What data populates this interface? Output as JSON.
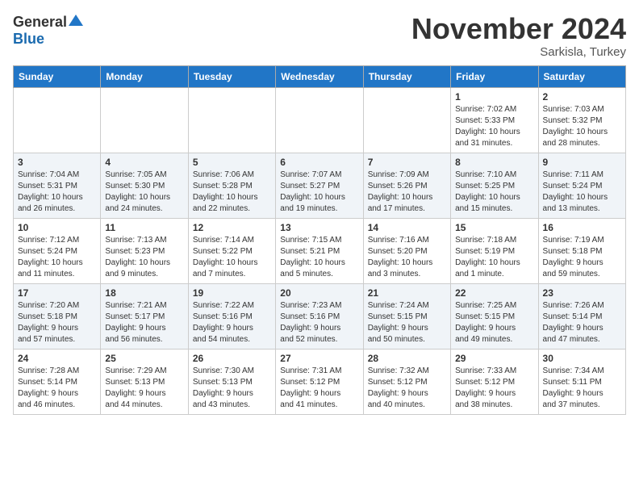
{
  "header": {
    "logo_general": "General",
    "logo_blue": "Blue",
    "month": "November 2024",
    "location": "Sarkisla, Turkey"
  },
  "weekdays": [
    "Sunday",
    "Monday",
    "Tuesday",
    "Wednesday",
    "Thursday",
    "Friday",
    "Saturday"
  ],
  "weeks": [
    [
      {
        "day": "",
        "info": ""
      },
      {
        "day": "",
        "info": ""
      },
      {
        "day": "",
        "info": ""
      },
      {
        "day": "",
        "info": ""
      },
      {
        "day": "",
        "info": ""
      },
      {
        "day": "1",
        "info": "Sunrise: 7:02 AM\nSunset: 5:33 PM\nDaylight: 10 hours\nand 31 minutes."
      },
      {
        "day": "2",
        "info": "Sunrise: 7:03 AM\nSunset: 5:32 PM\nDaylight: 10 hours\nand 28 minutes."
      }
    ],
    [
      {
        "day": "3",
        "info": "Sunrise: 7:04 AM\nSunset: 5:31 PM\nDaylight: 10 hours\nand 26 minutes."
      },
      {
        "day": "4",
        "info": "Sunrise: 7:05 AM\nSunset: 5:30 PM\nDaylight: 10 hours\nand 24 minutes."
      },
      {
        "day": "5",
        "info": "Sunrise: 7:06 AM\nSunset: 5:28 PM\nDaylight: 10 hours\nand 22 minutes."
      },
      {
        "day": "6",
        "info": "Sunrise: 7:07 AM\nSunset: 5:27 PM\nDaylight: 10 hours\nand 19 minutes."
      },
      {
        "day": "7",
        "info": "Sunrise: 7:09 AM\nSunset: 5:26 PM\nDaylight: 10 hours\nand 17 minutes."
      },
      {
        "day": "8",
        "info": "Sunrise: 7:10 AM\nSunset: 5:25 PM\nDaylight: 10 hours\nand 15 minutes."
      },
      {
        "day": "9",
        "info": "Sunrise: 7:11 AM\nSunset: 5:24 PM\nDaylight: 10 hours\nand 13 minutes."
      }
    ],
    [
      {
        "day": "10",
        "info": "Sunrise: 7:12 AM\nSunset: 5:24 PM\nDaylight: 10 hours\nand 11 minutes."
      },
      {
        "day": "11",
        "info": "Sunrise: 7:13 AM\nSunset: 5:23 PM\nDaylight: 10 hours\nand 9 minutes."
      },
      {
        "day": "12",
        "info": "Sunrise: 7:14 AM\nSunset: 5:22 PM\nDaylight: 10 hours\nand 7 minutes."
      },
      {
        "day": "13",
        "info": "Sunrise: 7:15 AM\nSunset: 5:21 PM\nDaylight: 10 hours\nand 5 minutes."
      },
      {
        "day": "14",
        "info": "Sunrise: 7:16 AM\nSunset: 5:20 PM\nDaylight: 10 hours\nand 3 minutes."
      },
      {
        "day": "15",
        "info": "Sunrise: 7:18 AM\nSunset: 5:19 PM\nDaylight: 10 hours\nand 1 minute."
      },
      {
        "day": "16",
        "info": "Sunrise: 7:19 AM\nSunset: 5:18 PM\nDaylight: 9 hours\nand 59 minutes."
      }
    ],
    [
      {
        "day": "17",
        "info": "Sunrise: 7:20 AM\nSunset: 5:18 PM\nDaylight: 9 hours\nand 57 minutes."
      },
      {
        "day": "18",
        "info": "Sunrise: 7:21 AM\nSunset: 5:17 PM\nDaylight: 9 hours\nand 56 minutes."
      },
      {
        "day": "19",
        "info": "Sunrise: 7:22 AM\nSunset: 5:16 PM\nDaylight: 9 hours\nand 54 minutes."
      },
      {
        "day": "20",
        "info": "Sunrise: 7:23 AM\nSunset: 5:16 PM\nDaylight: 9 hours\nand 52 minutes."
      },
      {
        "day": "21",
        "info": "Sunrise: 7:24 AM\nSunset: 5:15 PM\nDaylight: 9 hours\nand 50 minutes."
      },
      {
        "day": "22",
        "info": "Sunrise: 7:25 AM\nSunset: 5:15 PM\nDaylight: 9 hours\nand 49 minutes."
      },
      {
        "day": "23",
        "info": "Sunrise: 7:26 AM\nSunset: 5:14 PM\nDaylight: 9 hours\nand 47 minutes."
      }
    ],
    [
      {
        "day": "24",
        "info": "Sunrise: 7:28 AM\nSunset: 5:14 PM\nDaylight: 9 hours\nand 46 minutes."
      },
      {
        "day": "25",
        "info": "Sunrise: 7:29 AM\nSunset: 5:13 PM\nDaylight: 9 hours\nand 44 minutes."
      },
      {
        "day": "26",
        "info": "Sunrise: 7:30 AM\nSunset: 5:13 PM\nDaylight: 9 hours\nand 43 minutes."
      },
      {
        "day": "27",
        "info": "Sunrise: 7:31 AM\nSunset: 5:12 PM\nDaylight: 9 hours\nand 41 minutes."
      },
      {
        "day": "28",
        "info": "Sunrise: 7:32 AM\nSunset: 5:12 PM\nDaylight: 9 hours\nand 40 minutes."
      },
      {
        "day": "29",
        "info": "Sunrise: 7:33 AM\nSunset: 5:12 PM\nDaylight: 9 hours\nand 38 minutes."
      },
      {
        "day": "30",
        "info": "Sunrise: 7:34 AM\nSunset: 5:11 PM\nDaylight: 9 hours\nand 37 minutes."
      }
    ]
  ]
}
